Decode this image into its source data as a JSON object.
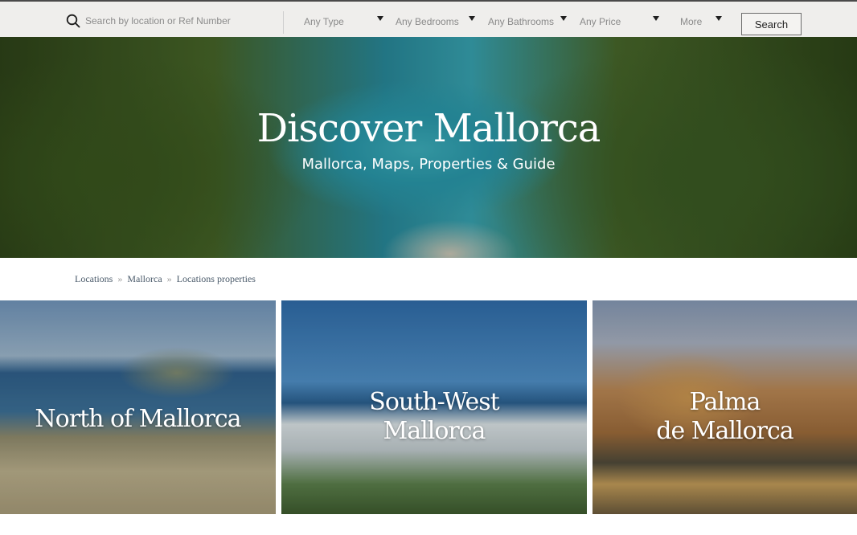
{
  "search": {
    "placeholder": "Search by location or Ref Number",
    "filters": [
      "Any Type",
      "Any Bedrooms",
      "Any Bathrooms",
      "Any Price",
      "More"
    ],
    "button_label": "Search"
  },
  "hero": {
    "title": "Discover Mallorca",
    "subtitle": "Mallorca, Maps, Properties & Guide"
  },
  "breadcrumb": {
    "items": [
      "Locations",
      "Mallorca",
      "Locations properties"
    ],
    "separator": "»"
  },
  "cards": [
    {
      "title_lines": [
        "North of Mallorca"
      ]
    },
    {
      "title_lines": [
        "South-West",
        "Mallorca"
      ]
    },
    {
      "title_lines": [
        "Palma",
        "de Mallorca"
      ]
    }
  ],
  "icons": {
    "search": "search-icon",
    "caret": "caret-down-icon"
  },
  "colors": {
    "searchbar_bg": "#efeeec",
    "breadcrumb_text": "#4a5a6a",
    "hero_text": "#ffffff"
  }
}
